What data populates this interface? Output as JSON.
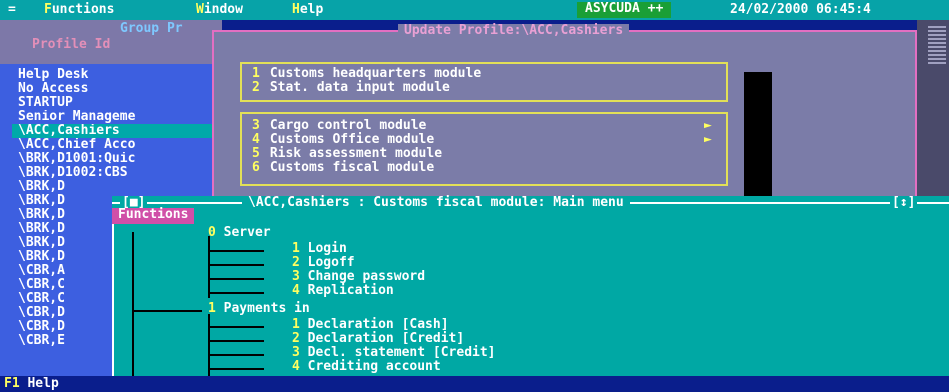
{
  "menubar": {
    "system_icon": "=",
    "items": [
      {
        "hot": "F",
        "rest": "unctions"
      },
      {
        "hot": "W",
        "rest": "indow"
      },
      {
        "hot": "H",
        "rest": "elp"
      }
    ],
    "app_name": "ASYCUDA ++",
    "datetime": "24/02/2000 06:45:4"
  },
  "profile_window": {
    "group_title": "Group Pr",
    "profile_title": "Profile Id",
    "items": [
      "Help Desk",
      "No Access",
      "STARTUP",
      "Senior Manageme",
      "\\ACC,Cashiers",
      "\\ACC,Chief Acco",
      "\\BRK,D1001:Quic",
      "\\BRK,D1002:CBS",
      "\\BRK,D",
      "\\BRK,D",
      "\\BRK,D",
      "\\BRK,D",
      "\\BRK,D",
      "\\BRK,D",
      "\\CBR,A",
      "\\CBR,C",
      "\\CBR,C",
      "\\CBR,D",
      "\\CBR,D",
      "\\CBR,E"
    ],
    "selected_index": 4
  },
  "update_window": {
    "title": "Update Profile:\\ACC,Cashiers",
    "group1": [
      {
        "num": "1",
        "label": "Customs headquarters module"
      },
      {
        "num": "2",
        "label": "Stat. data input module"
      }
    ],
    "group2": [
      {
        "num": "3",
        "label": "Cargo control module",
        "submenu": "►"
      },
      {
        "num": "4",
        "label": "Customs Office module",
        "submenu": "►"
      },
      {
        "num": "5",
        "label": "Risk assessment module"
      },
      {
        "num": "6",
        "label": "Customs fiscal module"
      }
    ]
  },
  "functions_window": {
    "close_button": "[■]",
    "title": "\\ACC,Cashiers : Customs fiscal module: Main menu",
    "maximize_button": "[↕]",
    "tab_label": "Functions",
    "tree": {
      "groups": [
        {
          "num": "0",
          "label": "Server",
          "items": [
            {
              "num": "1",
              "label": "Login"
            },
            {
              "num": "2",
              "label": "Logoff"
            },
            {
              "num": "3",
              "label": "Change password"
            },
            {
              "num": "4",
              "label": "Replication"
            }
          ]
        },
        {
          "num": "1",
          "label": "Payments in",
          "items": [
            {
              "num": "1",
              "label": "Declaration [Cash]"
            },
            {
              "num": "2",
              "label": "Declaration [Credit]"
            },
            {
              "num": "3",
              "label": "Decl. statement [Credit]"
            },
            {
              "num": "4",
              "label": "Crediting account"
            }
          ]
        }
      ]
    }
  },
  "statusbar": {
    "help_key": "F1",
    "help_label": "Help"
  },
  "colors": {
    "desktop": "#0a1e8c",
    "menubar": "#07a3a8",
    "hotkey": "#ffff60",
    "functions_bg": "#00a8a4",
    "profile_bg": "#3d5fe0",
    "update_bg": "#7b7ca8",
    "tab_bg": "#d04fa8",
    "app_badge": "#1a9f36"
  }
}
